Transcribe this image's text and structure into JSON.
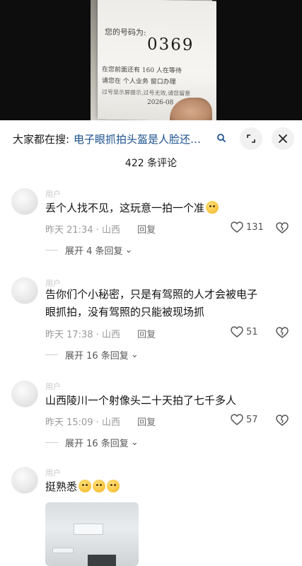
{
  "video": {
    "receipt_label": "您的号码为:",
    "receipt_number": "0369",
    "receipt_ahead": "在您前面还有 160 人在等待",
    "receipt_business": "请您在 个人业务 窗口办理",
    "receipt_notice": "过号显示屏提示,过号无效,请您留意",
    "receipt_date": "2026-08"
  },
  "search": {
    "prefix": "大家都在搜:",
    "query": "电子眼抓拍头盔是人脸还是车牌"
  },
  "comments_count": "422 条评论",
  "comments": [
    {
      "username": "用户",
      "text": "丢个人找不见，这玩意一拍一个准",
      "time": "昨天 21:34 · 山西",
      "reply_label": "回复",
      "likes": "131",
      "expand_label": "展开 4 条回复"
    },
    {
      "username": "用户",
      "text": "告你们个小秘密，只是有驾照的人才会被电子眼抓拍，没有驾照的只能被现场抓",
      "time": "昨天 17:38 · 山西",
      "reply_label": "回复",
      "likes": "51",
      "expand_label": "展开 16 条回复"
    },
    {
      "username": "用户",
      "text": "山西陵川一个射像头二十天拍了七千多人",
      "time": "昨天 15:09 · 山西",
      "reply_label": "回复",
      "likes": "57",
      "expand_label": "展开 16 条回复"
    },
    {
      "username": "用户",
      "text": "挺熟悉",
      "emoji_count": 3
    }
  ]
}
